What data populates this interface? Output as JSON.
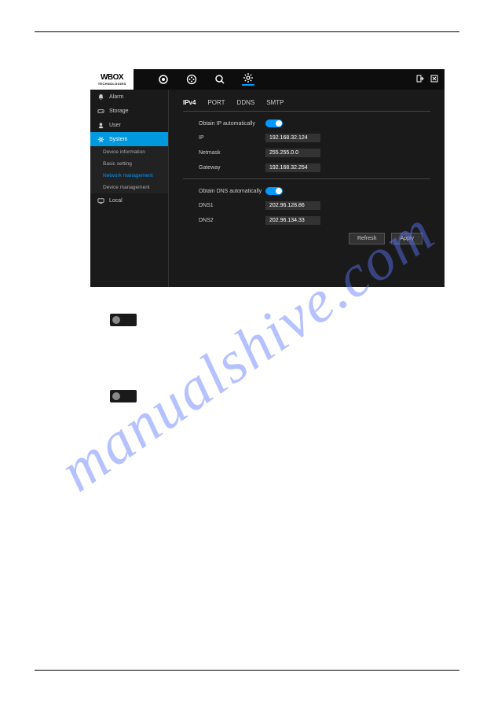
{
  "watermark": "manualshive.com",
  "logo": {
    "main": "WBOX",
    "sub": "TECHNOLOGIES"
  },
  "sidebar": {
    "items": [
      {
        "icon": "bell",
        "label": "Alarm"
      },
      {
        "icon": "disk",
        "label": "Storage"
      },
      {
        "icon": "user",
        "label": "User"
      },
      {
        "icon": "gear",
        "label": "System",
        "active": true
      },
      {
        "icon": "monitor",
        "label": "Local"
      }
    ],
    "subitems": [
      {
        "label": "Device information"
      },
      {
        "label": "Basic setting"
      },
      {
        "label": "Network management",
        "active": true
      },
      {
        "label": "Device management"
      }
    ]
  },
  "tabs": {
    "items": [
      {
        "label": "IPv4",
        "active": true
      },
      {
        "label": "PORT"
      },
      {
        "label": "DDNS"
      },
      {
        "label": "SMTP"
      }
    ]
  },
  "form": {
    "obtain_ip_label": "Obtain IP automatically",
    "ip_label": "IP",
    "ip_value": "192.168.32.124",
    "netmask_label": "Netmask",
    "netmask_value": "255.255.0.0",
    "gateway_label": "Gateway",
    "gateway_value": "192.168.32.254",
    "obtain_dns_label": "Obtain DNS automatically",
    "dns1_label": "DNS1",
    "dns1_value": "202.96.128.86",
    "dns2_label": "DNS2",
    "dns2_value": "202.96.134.33"
  },
  "buttons": {
    "refresh": "Refresh",
    "apply": "Apply"
  }
}
